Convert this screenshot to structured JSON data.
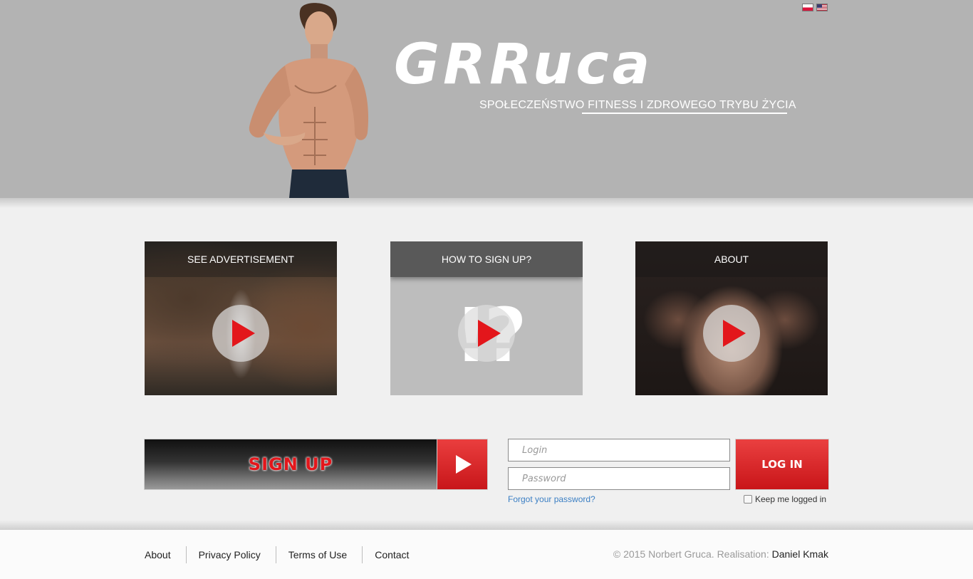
{
  "header": {
    "logo": "GRRuca",
    "tagline": "SPOŁECZEŃSTWO FITNESS I ZDROWEGO TRYBU ŻYCIA",
    "background_color": "#b3b3b3",
    "languages": [
      "pl-flag-icon",
      "en-flag-icon"
    ]
  },
  "cards": [
    {
      "title": "SEE ADVERTISEMENT",
      "icon": "play-icon"
    },
    {
      "title": "HOW TO SIGN UP?",
      "icon": "play-icon"
    },
    {
      "title": "ABOUT",
      "icon": "play-icon"
    }
  ],
  "signup": {
    "label": "SIGN UP",
    "icon": "play-icon"
  },
  "login": {
    "login_placeholder": "Login",
    "password_placeholder": "Password",
    "button": "LOG IN",
    "forgot": "Forgot your password?",
    "keep_logged": "Keep me logged in"
  },
  "footer": {
    "links": [
      "About",
      "Privacy Policy",
      "Terms of Use",
      "Contact"
    ],
    "copyright": "© 2015 Norbert Gruca. Realisation: ",
    "author": "Daniel Kmak"
  },
  "colors": {
    "accent": "#e3161b",
    "link": "#3b7fc4"
  }
}
